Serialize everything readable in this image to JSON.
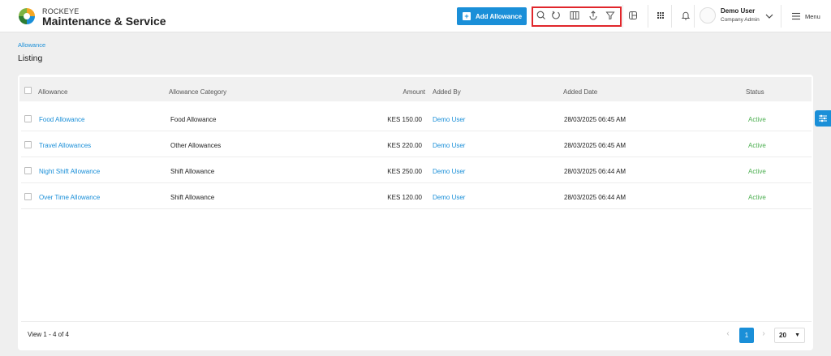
{
  "brand": {
    "small": "ROCKEYE",
    "title": "Maintenance & Service"
  },
  "header": {
    "add_button": "Add Allowance",
    "tools": [
      "search-icon",
      "refresh-icon",
      "columns-icon",
      "export-icon",
      "filter-icon"
    ],
    "user_name": "Demo User",
    "user_role": "Company Admin",
    "menu_label": "Menu"
  },
  "breadcrumb": "Allowance",
  "page_title": "Listing",
  "table": {
    "columns": [
      "Allowance",
      "Allowance Category",
      "Amount",
      "Added By",
      "Added Date",
      "Status"
    ],
    "rows": [
      {
        "name": "Food Allowance",
        "category": "Food Allowance",
        "amount": "KES 150.00",
        "added_by": "Demo User",
        "date": "28/03/2025 06:45 AM",
        "status": "Active"
      },
      {
        "name": "Travel Allowances",
        "category": "Other Allowances",
        "amount": "KES 220.00",
        "added_by": "Demo User",
        "date": "28/03/2025 06:45 AM",
        "status": "Active"
      },
      {
        "name": "Night Shift Allowance",
        "category": "Shift Allowance",
        "amount": "KES 250.00",
        "added_by": "Demo User",
        "date": "28/03/2025 06:44 AM",
        "status": "Active"
      },
      {
        "name": "Over Time Allowance",
        "category": "Shift Allowance",
        "amount": "KES 120.00",
        "added_by": "Demo User",
        "date": "28/03/2025 06:44 AM",
        "status": "Active"
      }
    ]
  },
  "footer": {
    "view_count": "View 1 - 4 of 4",
    "current_page": "1",
    "page_size": "20"
  },
  "colors": {
    "accent": "#1a8fd8",
    "active": "#4caf50",
    "highlight": "#e0262b"
  }
}
